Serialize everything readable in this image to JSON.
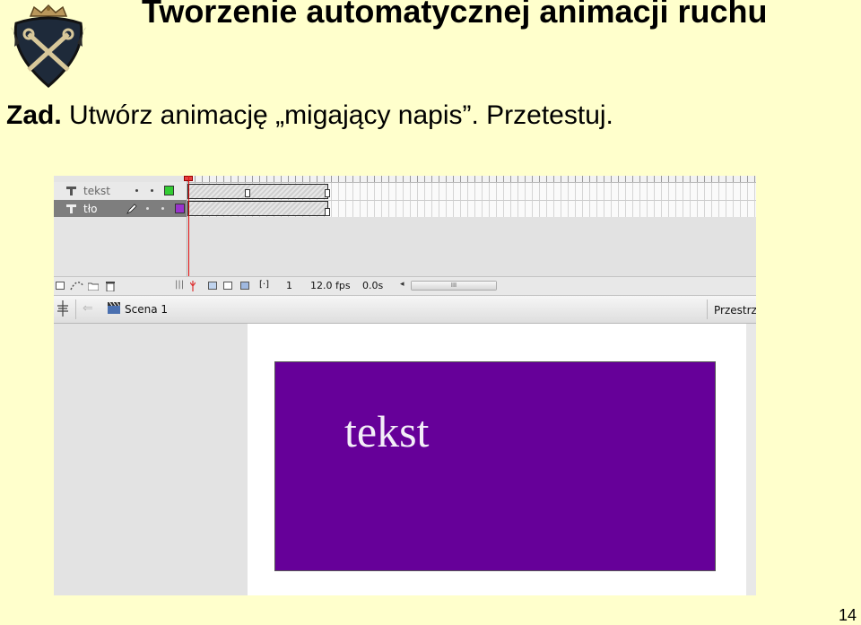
{
  "slide": {
    "title": "Tworzenie automatycznej animacji ruchu",
    "task_prefix": "Zad.",
    "task_text": " Utwórz animację „migający napis”. Przetestuj.",
    "page_number": "14"
  },
  "timeline": {
    "layers": [
      {
        "name": "tekst",
        "color": "#33CC33",
        "selected": false
      },
      {
        "name": "tło",
        "color": "#9933CC",
        "selected": true
      }
    ],
    "current_frame": "1",
    "fps": "12.0 fps",
    "elapsed": "0.0s",
    "scroll_thumb_label": "III"
  },
  "scene_bar": {
    "scene_label": "Scena 1",
    "right_label": "Przestrze"
  },
  "stage": {
    "background_color": "#660099",
    "text": "tekst"
  },
  "icons": [
    "crest-logo-icon",
    "layer-icon",
    "pencil-icon",
    "new-layer-icon",
    "motion-guide-icon",
    "folder-icon",
    "trash-icon",
    "onion-skin-icon",
    "edit-multiple-frames-icon",
    "modify-markers-icon",
    "back-arrow-icon",
    "scene-clapper-icon",
    "timeline-toggle-icon"
  ]
}
